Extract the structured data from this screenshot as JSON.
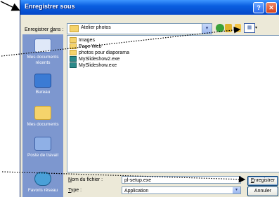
{
  "dialog": {
    "title": "Enregistrer sous",
    "help_glyph": "?",
    "close_glyph": "✕"
  },
  "toolbar": {
    "lookin_label_prefix": "Enregistrer ",
    "lookin_label_accel": "d",
    "lookin_label_suffix": "ans :",
    "lookin_value": "Atelier photos",
    "dropdown_glyph": "▾",
    "views_glyph": "▦",
    "views_arrow": "▾"
  },
  "places": [
    {
      "label": "Mes documents récents",
      "icon": "recent-documents-icon"
    },
    {
      "label": "Bureau",
      "icon": "desktop-icon"
    },
    {
      "label": "Mes documents",
      "icon": "my-documents-icon"
    },
    {
      "label": "Poste de travail",
      "icon": "my-computer-icon"
    },
    {
      "label": "Favoris réseau",
      "icon": "network-places-icon"
    }
  ],
  "files": [
    {
      "name": "Images",
      "type": "folder"
    },
    {
      "name": "Page Web",
      "type": "folder"
    },
    {
      "name": "photos pour diaporama",
      "type": "folder"
    },
    {
      "name": "MySlideshow2.exe",
      "type": "exe"
    },
    {
      "name": "MySlideshow.exe",
      "type": "exe"
    }
  ],
  "filename": {
    "label_accel": "N",
    "label_rest": "om du fichier :",
    "value": "pl-setup.exe"
  },
  "filetype": {
    "label_accel": "T",
    "label_rest": "ype :",
    "value": "Application"
  },
  "buttons": {
    "save_accel": "E",
    "save_rest": "nregistrer",
    "cancel": "Annuler"
  },
  "colors": {
    "title_bar": "#0a5fe0",
    "places_bar": "#7d97cf",
    "callout": "#000000"
  }
}
